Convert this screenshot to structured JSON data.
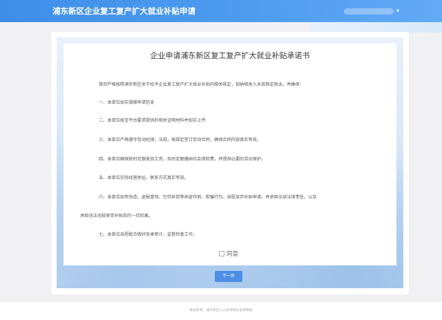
{
  "header": {
    "title": "浦东新区企业复工复产扩大就业补贴申请",
    "user_menu_icon": "chevron-down-icon"
  },
  "agreement": {
    "title": "企业申请浦东新区复工复产扩大就业补贴承诺书",
    "intro": "我司严格按照浦东新区关于给予企业复工复产扩大就业补贴的相关规定，现纳相关人员且稳定就业，并确保：",
    "clauses": [
      "一、本单位如实填报申请信息",
      "二、本单位按至平台要求提供的相关证明材料并如实上传",
      "三、本单位严格遵守劳动纪律、法规，按规定签订劳动合同，确保合同内容真实有效。",
      "四、本单位确保按时足额发放工资，及时足额缴纳社会保险费，并提供必要的劳动保护。",
      "五、本单位实际经营地址、联系方式真实有效。",
      "六、本单位如有伪造、虚报冒领、空岗非岗等弄虚作假、欺骗行为，自愿放弃补贴申请，并承担全部法律责任，以及",
      "承担违法违规享受补贴后的一切后果。",
      "七、本单位自愿配合做好各类审计、监督检查工作。"
    ],
    "consent_label": "同意",
    "next_button": "下一步"
  },
  "footer": {
    "text": "版权所有：浦东新区人力资源和社会保障局"
  },
  "colors": {
    "header_blue": "#3e8ee8",
    "button_blue": "#4c8fe4",
    "page_background": "#f1f1f3"
  }
}
